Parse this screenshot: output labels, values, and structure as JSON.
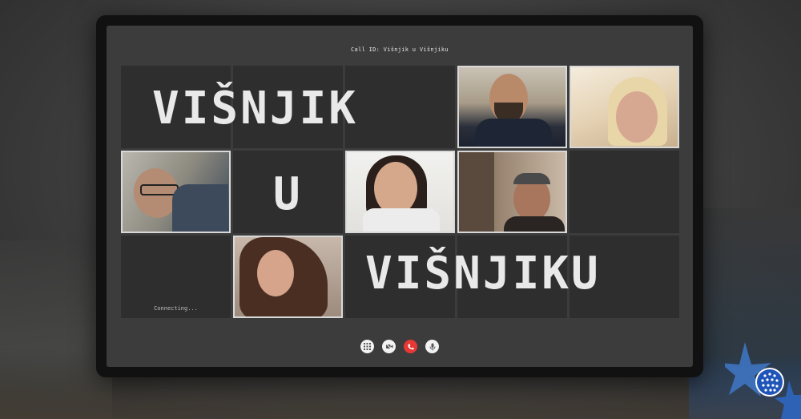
{
  "call": {
    "id_label": "Call ID: Višnjik u Višnjiku"
  },
  "overlay_text": {
    "line1": "VIŠNJIK",
    "line2": "U",
    "line3": "VIŠNJIKU"
  },
  "tiles": {
    "connecting_label": "Connecting..."
  },
  "controls": {
    "grid": "grid-icon",
    "video": "video-icon",
    "hangup": "phone-hangup-icon",
    "mic": "microphone-icon"
  },
  "colors": {
    "hangup": "#e53935",
    "tile_background": "#2e2e2e",
    "screen_background": "#3c3c3c"
  }
}
